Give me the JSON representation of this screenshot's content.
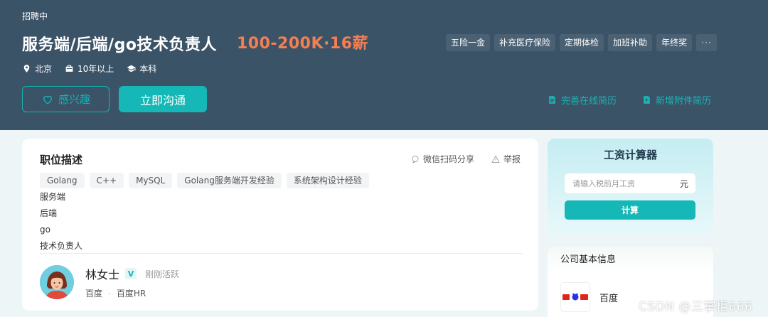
{
  "header": {
    "status": "招聘中",
    "job_title": "服务端/后端/go技术负责人",
    "salary": "100-200K·16薪",
    "benefits": [
      "五险一金",
      "补充医疗保险",
      "定期体检",
      "加班补助",
      "年终奖"
    ],
    "more_label": "···",
    "location": "北京",
    "experience": "10年以上",
    "education": "本科",
    "interest_label": "感兴趣",
    "chat_label": "立即沟通",
    "resume_online_label": "完善在线简历",
    "resume_attach_label": "新增附件简历"
  },
  "job_card": {
    "title": "职位描述",
    "share_label": "微信扫码分享",
    "report_label": "举报",
    "skills": [
      "Golang",
      "C++",
      "MySQL",
      "Golang服务端开发经验",
      "系统架构设计经验"
    ],
    "description_lines": [
      "服务端",
      "后端",
      "go",
      "技术负责人"
    ],
    "recruiter": {
      "name": "林女士",
      "verify_mark": "V",
      "active_status": "刚刚活跃",
      "company": "百度",
      "separator": "·",
      "title": "百度HR"
    }
  },
  "calculator": {
    "title": "工资计算器",
    "input_placeholder": "请输入税前月工资",
    "unit": "元",
    "button_label": "计算"
  },
  "company": {
    "section_title": "公司基本信息",
    "name": "百度"
  },
  "watermark": "CSDN @三掌柜666",
  "colors": {
    "header_bg": "#3b5367",
    "accent_teal": "#15b8b6",
    "salary_orange": "#f47f53"
  }
}
